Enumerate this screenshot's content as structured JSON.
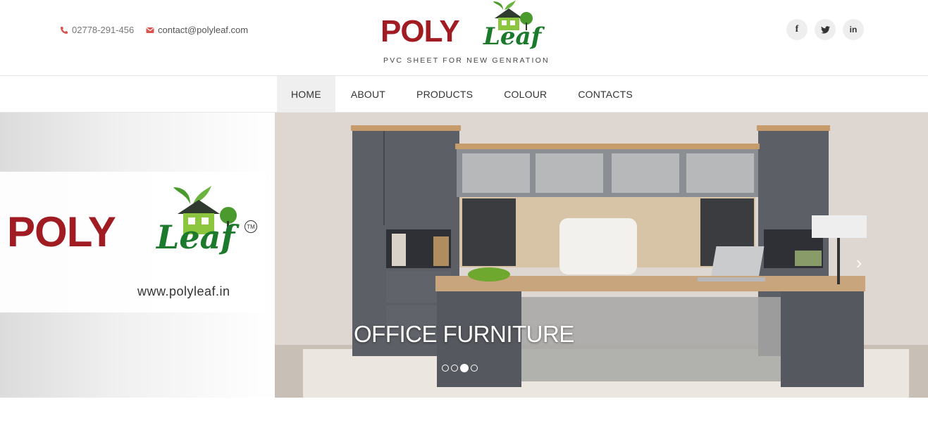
{
  "header": {
    "phone": "02778-291-456",
    "email": "contact@polyleaf.com",
    "logo": {
      "brand_main": "POLY",
      "brand_script": "Leaf",
      "tagline": "PVC SHEET FOR NEW GENRATION"
    },
    "social": [
      {
        "icon": "facebook-icon",
        "label": "f"
      },
      {
        "icon": "twitter-icon",
        "label": "🐦"
      },
      {
        "icon": "linkedin-icon",
        "label": "in"
      }
    ]
  },
  "nav": {
    "items": [
      "HOME",
      "ABOUT",
      "PRODUCTS",
      "COLOUR",
      "CONTACTS"
    ],
    "active": "HOME"
  },
  "slider": {
    "left_panel": {
      "brand_main": "POLY",
      "brand_script": "Leaf",
      "trademark": "TM",
      "website": "www.polyleaf.in"
    },
    "caption": "OFFICE FURNITURE",
    "slide_count": 4,
    "active_slide": 3
  },
  "colors": {
    "brand_red": "#a01c22",
    "brand_green": "#1c7a2c",
    "accent_red": "#d9534f"
  }
}
